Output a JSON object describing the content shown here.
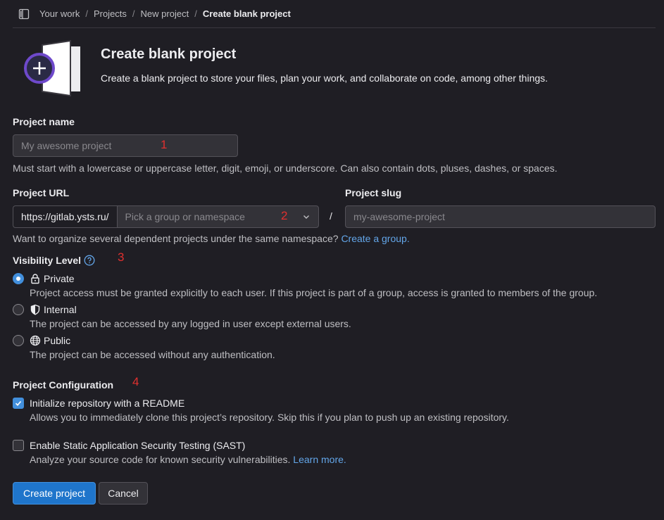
{
  "breadcrumb": {
    "items": [
      "Your work",
      "Projects",
      "New project"
    ],
    "current": "Create blank project"
  },
  "header": {
    "title": "Create blank project",
    "subtitle": "Create a blank project to store your files, plan your work, and collaborate on code, among other things."
  },
  "project_name": {
    "label": "Project name",
    "value": "",
    "placeholder": "My awesome project",
    "help": "Must start with a lowercase or uppercase letter, digit, emoji, or underscore. Can also contain dots, pluses, dashes, or spaces."
  },
  "project_url": {
    "label": "Project URL",
    "prefix": "https://gitlab.ysts.ru/",
    "namespace_placeholder": "Pick a group or namespace",
    "separator": "/",
    "help": "Want to organize several dependent projects under the same namespace?",
    "help_link": "Create a group."
  },
  "project_slug": {
    "label": "Project slug",
    "value": "",
    "placeholder": "my-awesome-project"
  },
  "visibility": {
    "label": "Visibility Level",
    "selected": "private",
    "options": [
      {
        "key": "private",
        "label": "Private",
        "icon": "lock-icon",
        "description": "Project access must be granted explicitly to each user. If this project is part of a group, access is granted to members of the group."
      },
      {
        "key": "internal",
        "label": "Internal",
        "icon": "shield-icon",
        "description": "The project can be accessed by any logged in user except external users."
      },
      {
        "key": "public",
        "label": "Public",
        "icon": "globe-icon",
        "description": "The project can be accessed without any authentication."
      }
    ]
  },
  "configuration": {
    "label": "Project Configuration",
    "options": [
      {
        "label": "Initialize repository with a README",
        "checked": true,
        "description": "Allows you to immediately clone this project’s repository. Skip this if you plan to push up an existing repository.",
        "link": ""
      },
      {
        "label": "Enable Static Application Security Testing (SAST)",
        "checked": false,
        "description": "Analyze your source code for known security vulnerabilities.",
        "link": "Learn more."
      }
    ]
  },
  "annotations": [
    "1",
    "2",
    "3",
    "4"
  ],
  "actions": {
    "create": "Create project",
    "cancel": "Cancel"
  },
  "colors": {
    "background": "#1f1e24",
    "input_bg": "#333238",
    "border": "#535158",
    "primary": "#1f75cb",
    "link": "#63a6e9",
    "annotation": "#e0302f",
    "illustration_accent": "#6e49cb"
  }
}
